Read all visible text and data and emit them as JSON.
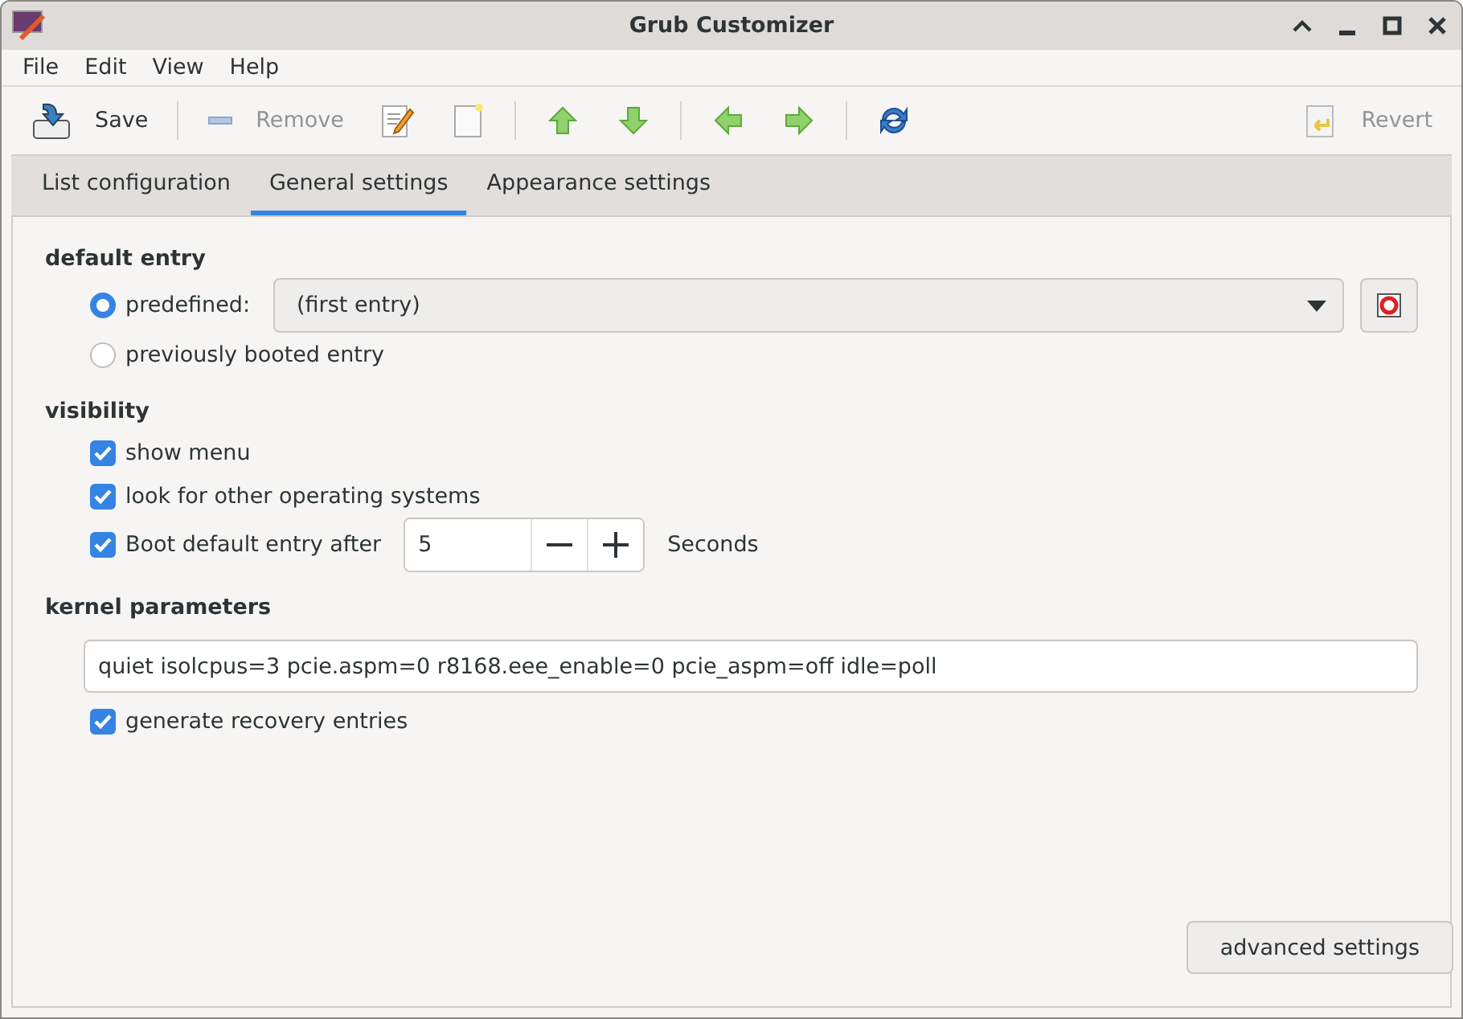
{
  "window": {
    "title": "Grub Customizer"
  },
  "menu": [
    "File",
    "Edit",
    "View",
    "Help"
  ],
  "toolbar": {
    "save": {
      "label": "Save",
      "disabled": false
    },
    "remove": {
      "label": "Remove",
      "disabled": true
    },
    "revert": {
      "label": "Revert",
      "disabled": true
    }
  },
  "tabs": [
    {
      "label": "List configuration",
      "selected": false
    },
    {
      "label": "General settings",
      "selected": true
    },
    {
      "label": "Appearance settings",
      "selected": false
    }
  ],
  "default_entry": {
    "heading": "default entry",
    "options": [
      {
        "label": "predefined:",
        "selected": true,
        "kind": "combo",
        "value": "(first entry)"
      },
      {
        "label": "previously booted entry",
        "selected": false,
        "kind": "plain"
      }
    ]
  },
  "visibility": {
    "heading": "visibility",
    "items": [
      {
        "label": "show menu",
        "checked": true,
        "kind": "plain"
      },
      {
        "label": "look for other operating systems",
        "checked": true,
        "kind": "plain"
      },
      {
        "label": "Boot default entry after",
        "checked": true,
        "kind": "spinner",
        "value": "5",
        "unit": "Seconds"
      }
    ]
  },
  "kernel_parameters": {
    "heading": "kernel parameters",
    "value": "quiet isolcpus=3 pcie.aspm=0 r8168.eee_enable=0 pcie_aspm=off idle=poll",
    "recovery": {
      "label": "generate recovery entries",
      "checked": true
    }
  },
  "advanced_button": "advanced settings"
}
